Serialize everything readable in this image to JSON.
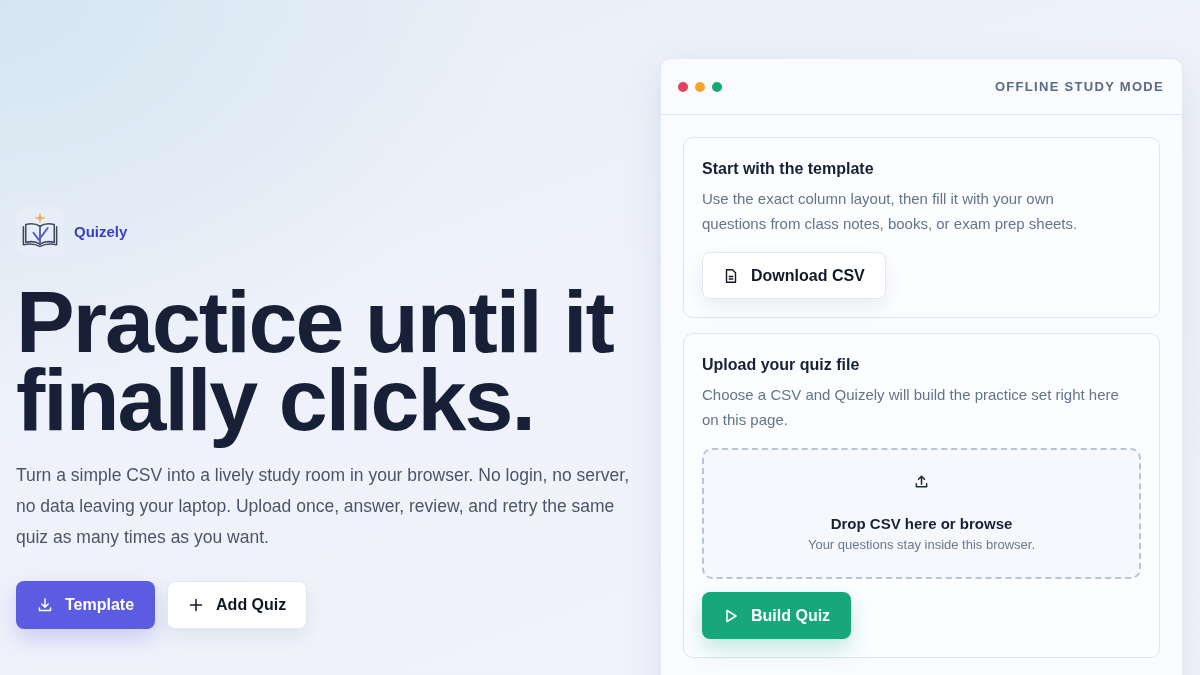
{
  "brand": {
    "name": "Quizely"
  },
  "hero": {
    "headline": "Practice until it finally clicks.",
    "description": "Turn a simple CSV into a lively study room in your browser. No login, no server, no data leaving your laptop. Upload once, answer, review, and retry the same quiz as many times as you want.",
    "buttons": [
      {
        "label": "Template",
        "kind": "primary"
      },
      {
        "label": "Add Quiz",
        "kind": "secondary"
      }
    ]
  },
  "panel": {
    "window_dots": [
      {
        "color": "#e0435f"
      },
      {
        "color": "#f2a52a"
      },
      {
        "color": "#14a878"
      }
    ],
    "mode_label": "OFFLINE STUDY MODE",
    "cards": [
      {
        "title": "Start with the template",
        "description": "Use the exact column layout, then fill it with your own questions from class notes, books, or exam prep sheets.",
        "button": {
          "label": "Download CSV",
          "kind": "secondary"
        }
      },
      {
        "title": "Upload your quiz file",
        "description": "Choose a CSV and Quizely will build the practice set right here on this page.",
        "dropzone": {
          "title": "Drop CSV here or browse",
          "hint": "Your questions stay inside this browser."
        },
        "button": {
          "label": "Build Quiz",
          "kind": "success"
        }
      }
    ]
  }
}
